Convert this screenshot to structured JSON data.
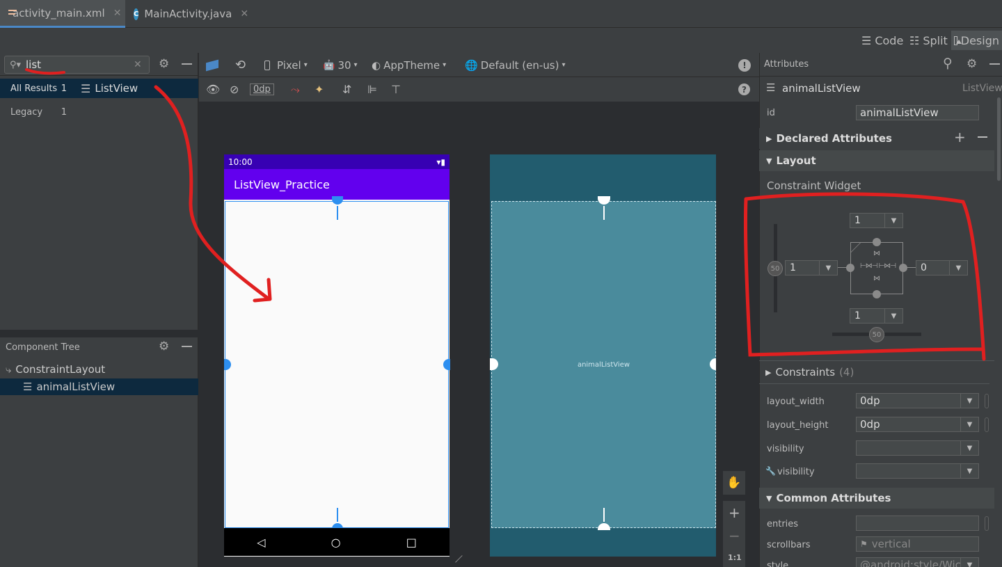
{
  "tabs": [
    {
      "label": "activity_main.xml",
      "icon": "xml-file-icon"
    },
    {
      "label": "MainActivity.java",
      "icon": "java-class-icon"
    }
  ],
  "view_modes": [
    "Code",
    "Split",
    "Design"
  ],
  "palette": {
    "search_value": "list",
    "categories": [
      {
        "label": "All Results",
        "count": "1"
      },
      {
        "label": "Legacy",
        "count": "1"
      }
    ],
    "results": [
      "ListView"
    ]
  },
  "component_tree": {
    "title": "Component Tree",
    "root": "ConstraintLayout",
    "child": "animalListView"
  },
  "canvas_toolbar": {
    "device": "Pixel",
    "api": "30",
    "theme": "AppTheme",
    "locale": "Default (en-us)",
    "margin": "0dp"
  },
  "preview": {
    "status_time": "10:00",
    "app_title": "ListView_Practice",
    "blueprint_label": "animalListView"
  },
  "zoom": {
    "fit_label": "1:1"
  },
  "attributes": {
    "title": "Attributes",
    "widget_name": "animalListView",
    "widget_type": "ListView",
    "id_label": "id",
    "id_value": "animalListView",
    "declared_section": "Declared Attributes",
    "layout_section": "Layout",
    "constraint_widget_label": "Constraint Widget",
    "top_margin": "1",
    "left_margin": "1",
    "right_margin": "0",
    "bottom_margin": "1",
    "vertical_bias": "50",
    "horizontal_bias": "50",
    "constraints_label": "Constraints",
    "constraints_count": "(4)",
    "rows": [
      {
        "label": "layout_width",
        "value": "0dp"
      },
      {
        "label": "layout_height",
        "value": "0dp"
      },
      {
        "label": "visibility",
        "value": ""
      },
      {
        "label": "visibility",
        "value": ""
      }
    ],
    "common_section": "Common Attributes",
    "common_rows": [
      {
        "label": "entries",
        "value": ""
      },
      {
        "label": "scrollbars",
        "value": "vertical"
      },
      {
        "label": "style",
        "value": "@android:style/Wic"
      }
    ]
  },
  "colors": {
    "status_bar": "#3700b3",
    "app_bar": "#6200ee",
    "blueprint_bg": "#225c6e",
    "blueprint_view": "#4a8b9c",
    "annotation": "#e02020",
    "selection": "#2d8ff0"
  }
}
